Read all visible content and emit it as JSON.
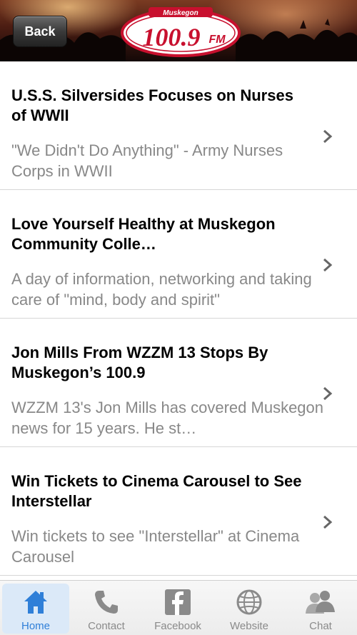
{
  "header": {
    "back_label": "Back",
    "logo": {
      "city": "Muskegon",
      "frequency": "100.9",
      "suffix": "FM"
    }
  },
  "feed": {
    "items": [
      {
        "title": "U.S.S. Silversides Focuses on Nurses of WWII",
        "description": "\"We Didn't Do Anything\" - Army Nurses Corps in WWII"
      },
      {
        "title": "Love Yourself Healthy at Muskegon Community Colle…",
        "description": "A day of information, networking and taking care of \"mind, body and spirit\""
      },
      {
        "title": "Jon Mills From WZZM 13 Stops By Muskegon’s 100.9",
        "description": "WZZM 13's Jon Mills has covered Muskegon news for 15 years.  He st…"
      },
      {
        "title": "Win Tickets to Cinema Carousel to See Interstellar",
        "description": "Win tickets to see \"Interstellar\" at Cinema Carousel"
      }
    ]
  },
  "tabs": [
    {
      "label": "Home",
      "icon": "home-icon",
      "active": true
    },
    {
      "label": "Contact",
      "icon": "phone-icon",
      "active": false
    },
    {
      "label": "Facebook",
      "icon": "facebook-icon",
      "active": false
    },
    {
      "label": "Website",
      "icon": "globe-icon",
      "active": false
    },
    {
      "label": "Chat",
      "icon": "people-icon",
      "active": false
    }
  ],
  "colors": {
    "accent": "#2f7fd8",
    "logo_red": "#c8102e"
  }
}
